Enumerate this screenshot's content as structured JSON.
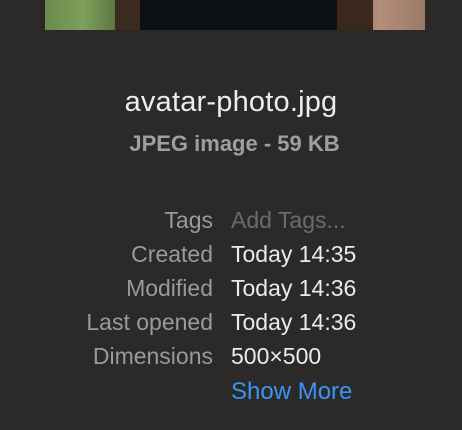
{
  "file": {
    "name": "avatar-photo.jpg",
    "kind_size": "JPEG image - 59 KB"
  },
  "metadata": [
    {
      "label": "Tags",
      "value": "Add Tags...",
      "placeholder": true
    },
    {
      "label": "Created",
      "value": "Today 14:35"
    },
    {
      "label": "Modified",
      "value": "Today 14:36"
    },
    {
      "label": "Last opened",
      "value": "Today 14:36"
    },
    {
      "label": "Dimensions",
      "value": "500×500"
    }
  ],
  "show_more_label": "Show More",
  "colors": {
    "background": "#2b2a29",
    "link": "#3b93f5"
  }
}
